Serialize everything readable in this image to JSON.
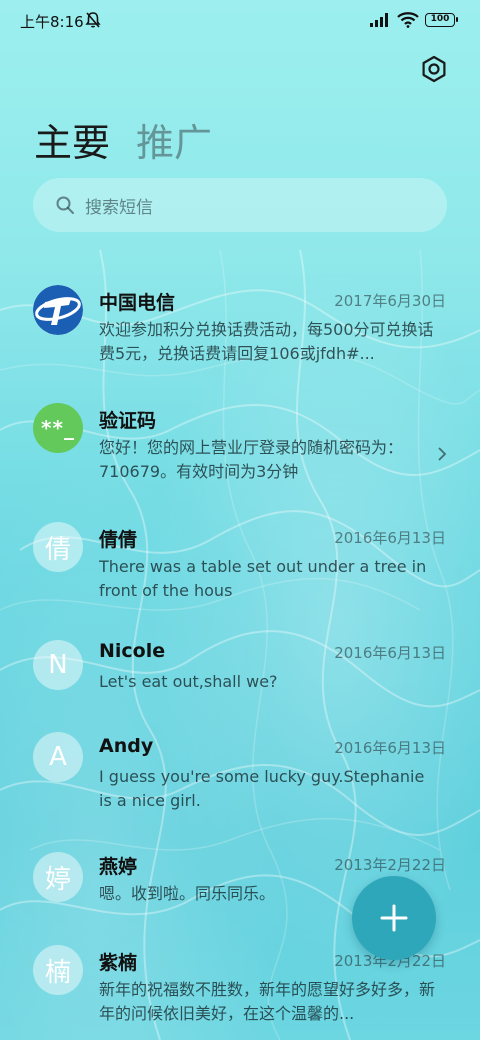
{
  "status_bar": {
    "time": "上午8:16",
    "battery": "100",
    "icons": [
      "mute-icon",
      "signal-icon",
      "wifi-icon",
      "battery-icon"
    ]
  },
  "header": {
    "settings_icon": "settings-hex-icon",
    "tabs": [
      {
        "label": "主要",
        "active": true
      },
      {
        "label": "推广",
        "active": false
      }
    ]
  },
  "search": {
    "placeholder": "搜索短信",
    "icon": "search-icon"
  },
  "messages": [
    {
      "sender": "中国电信",
      "date": "2017年6月30日",
      "preview": "欢迎参加积分兑换话费活动，每500分可兑换话费5元，兑换话费请回复106或jfdh#...",
      "avatar": "telecom-logo"
    },
    {
      "sender": "验证码",
      "date": "",
      "preview": "您好！您的网上营业厅登录的随机密码为：710679。有效时间为3分钟",
      "avatar_text": "**_"
    },
    {
      "sender": "倩倩",
      "date": "2016年6月13日",
      "preview": "There was a table set out under a tree in front of the hous",
      "avatar_text": "倩"
    },
    {
      "sender": "Nicole",
      "date": "2016年6月13日",
      "preview": "Let's eat out,shall we?",
      "avatar_text": "N"
    },
    {
      "sender": "Andy",
      "date": "2016年6月13日",
      "preview": "I guess you're some lucky guy.Stephanie is a nice girl.",
      "avatar_text": "A"
    },
    {
      "sender": "燕婷",
      "date": "2013年2月22日",
      "preview": "嗯。收到啦。同乐同乐。",
      "avatar_text": "婷"
    },
    {
      "sender": "紫楠",
      "date": "2013年2月22日",
      "preview": "新年的祝福数不胜数，新年的愿望好多好多，新年的问候依旧美好，在这个温馨的...",
      "avatar_text": "楠"
    }
  ],
  "fab": {
    "icon": "plus-icon"
  },
  "colors": {
    "fab": "#2fa7ba",
    "background": "#8fe8ea",
    "verify_avatar": "#62c95a"
  }
}
